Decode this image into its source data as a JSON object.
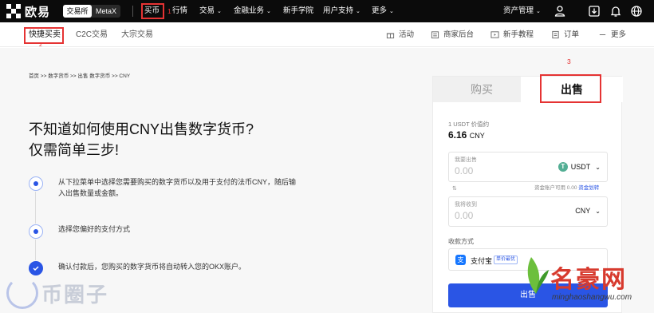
{
  "topbar": {
    "brand": "欧易",
    "segment": [
      "交易所",
      "MetaX"
    ],
    "nav": {
      "buy": "买币",
      "market": "行情",
      "trade": "交易",
      "finance": "金融业务",
      "academy": "新手学院",
      "support": "用户支持",
      "more": "更多"
    },
    "asset_mgmt": "资产管理"
  },
  "annotations": {
    "a1": "1",
    "a2": "2",
    "a3": "3"
  },
  "subnav": {
    "tabs": [
      "快捷买卖",
      "C2C交易",
      "大宗交易"
    ],
    "right": [
      "活动",
      "商家后台",
      "新手教程",
      "订单",
      "更多"
    ]
  },
  "breadcrumb": "首页 >> 数字货币 >> 出售 数字货币 >> CNY",
  "headline": {
    "line1": "不知道如何使用CNY出售数字货币?",
    "line2": "仅需简单三步!"
  },
  "steps": [
    {
      "text": "从下拉菜单中选择您需要购买的数字货币以及用于支付的法币CNY，随后输入出售数量或金额。"
    },
    {
      "text": "选择您偏好的支付方式"
    },
    {
      "text": "确认付款后，您购买的数字货币将自动转入您的OKX账户。"
    }
  ],
  "panel": {
    "tab_buy": "购买",
    "tab_sell": "出售",
    "rate_label": "1 USDT 价值约",
    "rate_value": "6.16",
    "rate_currency": "CNY",
    "field1": {
      "label": "我要出售",
      "value": "0.00",
      "currency": "USDT"
    },
    "available": "资金账户可用 0.00",
    "transfer": "资金划转",
    "field2": {
      "label": "我将收到",
      "value": "0.00",
      "currency": "CNY"
    },
    "pay_label": "收款方式",
    "pay_method": "支付宝",
    "pay_badge": "单价最优",
    "sell_button": "出售"
  },
  "watermarks": {
    "left": "币圈子",
    "right": "名豪网",
    "right_url": "minghaoshangwu.com"
  },
  "colors": {
    "accent": "#2a55e5",
    "annotation": "#e53333",
    "topbar": "#0b0b0b"
  }
}
